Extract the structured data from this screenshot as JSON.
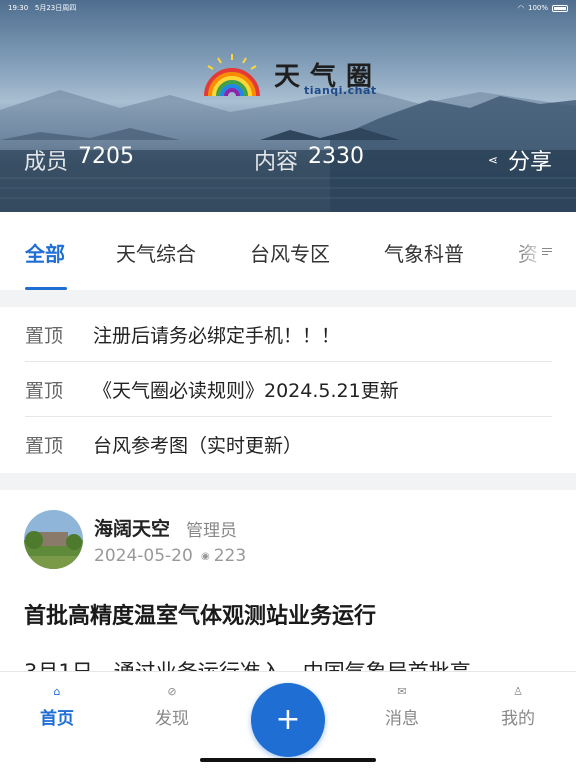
{
  "status_bar": {
    "time": "19:30",
    "date": "5月23日周四",
    "battery": "100%"
  },
  "logo": {
    "title": "天气圈",
    "subtitle": "tianqi.chat"
  },
  "stats": {
    "members_label": "成员",
    "members_value": "7205",
    "content_label": "内容",
    "content_value": "2330",
    "share_label": "分享"
  },
  "tabs": [
    {
      "label": "全部",
      "active": true
    },
    {
      "label": "天气综合"
    },
    {
      "label": "台风专区"
    },
    {
      "label": "气象科普"
    },
    {
      "label": "资"
    }
  ],
  "pinned": [
    {
      "tag": "置顶",
      "text": "注册后请务必绑定手机！！！"
    },
    {
      "tag": "置顶",
      "text": "《天气圈必读规则》2024.5.21更新"
    },
    {
      "tag": "置顶",
      "text": "台风参考图（实时更新）"
    }
  ],
  "post": {
    "author": "海阔天空",
    "role": "管理员",
    "date": "2024-05-20",
    "views": "223",
    "title": "首批高精度温室气体观测站业务运行",
    "body": "3月1日，通过业务运行准入，中国气象局首批高"
  },
  "bottom_nav": [
    {
      "label": "首页",
      "icon": "home-icon",
      "active": true
    },
    {
      "label": "发现",
      "icon": "compass-icon"
    },
    {
      "label": "消息",
      "icon": "mail-icon"
    },
    {
      "label": "我的",
      "icon": "user-icon"
    }
  ],
  "fab": {
    "label": "+"
  },
  "colors": {
    "accent": "#1f6ed4"
  }
}
